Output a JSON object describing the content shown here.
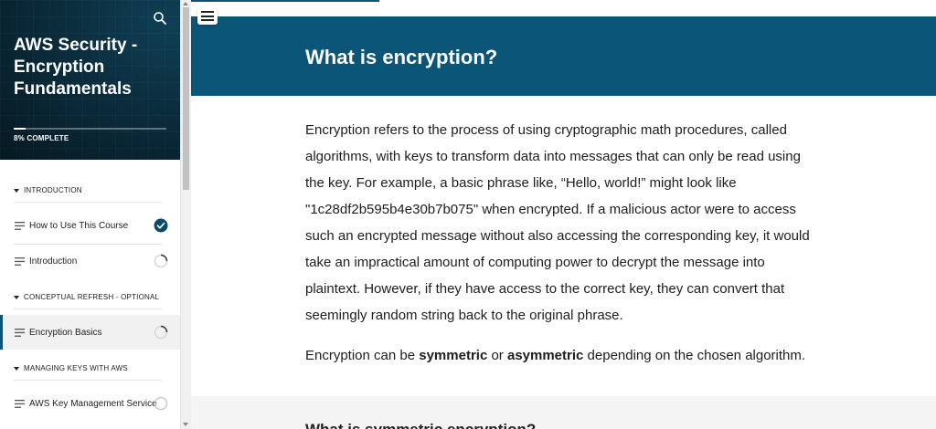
{
  "sidebar": {
    "course_title": "AWS Security - Encryption Fundamentals",
    "progress_percent": 8,
    "progress_label": "8% COMPLETE",
    "sections": [
      {
        "title": "INTRODUCTION",
        "lessons": [
          {
            "label": "How to Use This Course",
            "status": "complete"
          },
          {
            "label": "Introduction",
            "status": "in-progress"
          }
        ]
      },
      {
        "title": "CONCEPTUAL REFRESH - OPTIONAL",
        "lessons": [
          {
            "label": "Encryption Basics",
            "status": "in-progress",
            "active": true
          }
        ]
      },
      {
        "title": "MANAGING KEYS WITH AWS",
        "lessons": [
          {
            "label": "AWS Key Management Service",
            "status": "not-started"
          }
        ]
      }
    ]
  },
  "icons": {
    "search": "search-icon",
    "menu": "hamburger-menu-icon",
    "lesson": "lesson-lines-icon",
    "complete": "check-circle-icon",
    "in_progress": "progress-ring-icon",
    "not_started": "empty-circle-icon"
  },
  "colors": {
    "brand": "#0b5579",
    "sidebar_header": "#0b2d3d",
    "complete_badge": "#0b4a6b"
  },
  "main": {
    "lesson_title": "What is encryption?",
    "paragraph1": "Encryption refers to the process of using cryptographic math procedures, called algorithms, with keys to transform data into messages that can only be read using the key. For example, a basic phrase like, “Hello, world!” might look like \"1c28df2b595b4e30b7b075\" when encrypted. If a malicious actor were to access such an encrypted message without also accessing the corresponding key, it would take an impractical amount of computing power to decrypt the message into plaintext. However, if they have access to the correct key, they can convert that seemingly random string back to the original phrase.",
    "paragraph2": {
      "prefix": "Encryption can be ",
      "term1": "symmetric",
      "middle": " or ",
      "term2": "asymmetric",
      "suffix": " depending on the chosen algorithm."
    },
    "next_heading": "What is symmetric encryption?"
  }
}
